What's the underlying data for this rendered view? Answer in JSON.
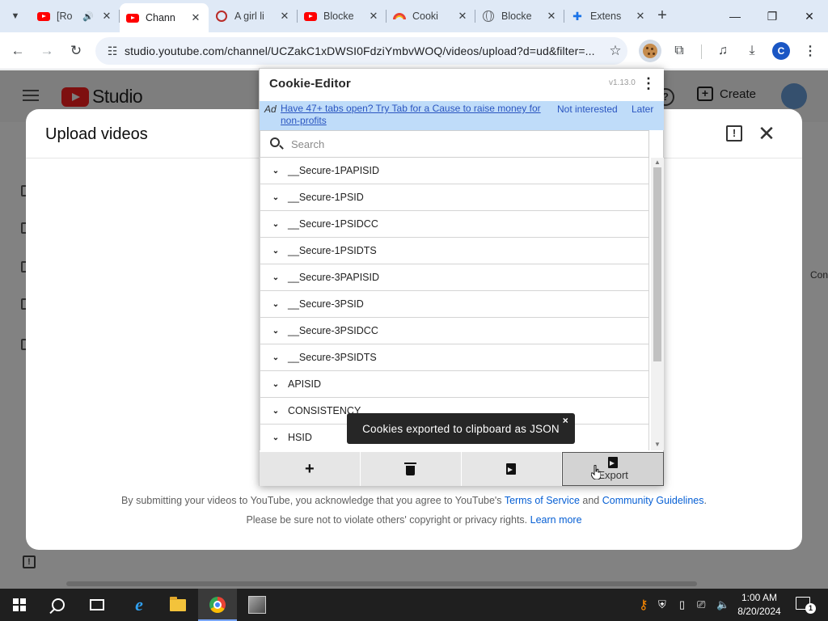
{
  "browser": {
    "tabs": [
      {
        "title": "[Ro",
        "icon": "youtube-icon",
        "audio": true,
        "active": false
      },
      {
        "title": "Chann",
        "icon": "youtube-icon",
        "audio": false,
        "active": true
      },
      {
        "title": "A girl li",
        "icon": "quora-icon",
        "audio": false,
        "active": false
      },
      {
        "title": "Blocke",
        "icon": "youtube-icon",
        "audio": false,
        "active": false
      },
      {
        "title": "Cooki",
        "icon": "rainbow-icon",
        "audio": false,
        "active": false
      },
      {
        "title": "Blocke",
        "icon": "globe-icon",
        "audio": false,
        "active": false
      },
      {
        "title": "Extens",
        "icon": "puzzle-icon",
        "audio": false,
        "active": false
      }
    ],
    "new_tab": "+",
    "url": "studio.youtube.com/channel/UCZakC1xDWSI0FdziYmbvWOQ/videos/upload?d=ud&filter=...",
    "profile_initial": "C"
  },
  "studio": {
    "brand": "Studio",
    "create_label": "Create",
    "right_edge_text": "Con"
  },
  "dialog": {
    "title": "Upload videos",
    "terms_line1_prefix": "By submitting your videos to YouTube, you acknowledge that you agree to YouTube's",
    "terms_link": "Terms of Service",
    "terms_and": "and",
    "guidelines_link": "Community Guidelines",
    "terms_line2_prefix": "Please be sure not to violate others' copyright or privacy rights.",
    "learn_more": "Learn more",
    "terms_period": "."
  },
  "cookie_editor": {
    "title": "Cookie-Editor",
    "version": "v1.13.0",
    "ad_label": "Ad",
    "ad_text": "Have 47+ tabs open? Try Tab for a Cause to raise money for non-profits",
    "ad_dismiss": "Not interested",
    "ad_later": "Later",
    "search_placeholder": "Search",
    "cookies": [
      "__Secure-1PAPISID",
      "__Secure-1PSID",
      "__Secure-1PSIDCC",
      "__Secure-1PSIDTS",
      "__Secure-3PAPISID",
      "__Secure-3PSID",
      "__Secure-3PSIDCC",
      "__Secure-3PSIDTS",
      "APISID",
      "CONSISTENCY",
      "HSID"
    ],
    "actions": {
      "add": "+",
      "export": "Export"
    },
    "toast": "Cookies exported to clipboard as JSON",
    "toast_close": "×"
  },
  "taskbar": {
    "time": "1:00 AM",
    "date": "8/20/2024",
    "notification_count": "1"
  },
  "colors": {
    "tabstrip": "#dfe9f6",
    "ad_bar": "#bfdcf9",
    "link": "#065fd4",
    "toast": "#262626",
    "taskbar": "#1f1f1f"
  }
}
